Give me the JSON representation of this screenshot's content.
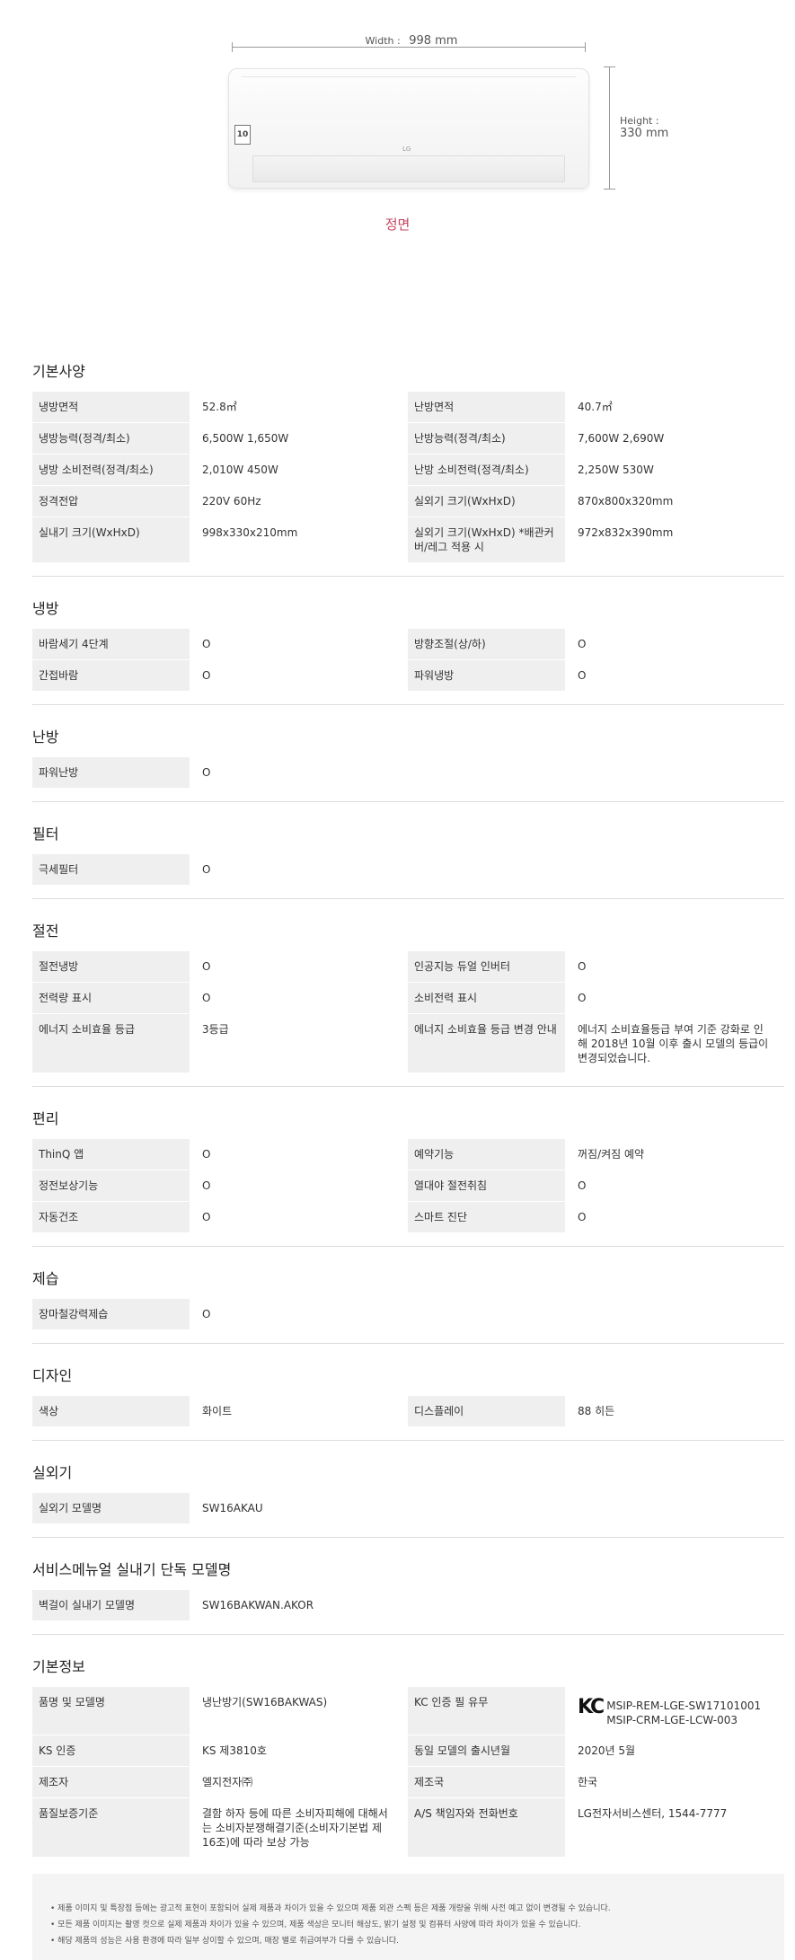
{
  "hero": {
    "width_label": "Width :",
    "width_value": "998 mm",
    "height_label": "Height :",
    "height_value": "330 mm",
    "badge_text": "10",
    "logo_text": "LG",
    "caption": "정면"
  },
  "sections": [
    {
      "title": "기본사양",
      "rows": [
        [
          "냉방면적",
          "52.8㎡",
          "난방면적",
          "40.7㎡"
        ],
        [
          "냉방능력(정격/최소)",
          "6,500W 1,650W",
          "난방능력(정격/최소)",
          "7,600W 2,690W"
        ],
        [
          "냉방 소비전력(정격/최소)",
          "2,010W 450W",
          "난방 소비전력(정격/최소)",
          "2,250W 530W"
        ],
        [
          "정격전압",
          "220V 60Hz",
          "실외기 크기(WxHxD)",
          "870x800x320mm"
        ],
        [
          "실내기 크기(WxHxD)",
          "998x330x210mm",
          "실외기 크기(WxHxD) *배관커버/레그 적용 시",
          "972x832x390mm"
        ]
      ]
    },
    {
      "title": "냉방",
      "rows": [
        [
          "바람세기 4단계",
          "O",
          "방향조절(상/하)",
          "O"
        ],
        [
          "간접바람",
          "O",
          "파워냉방",
          "O"
        ]
      ]
    },
    {
      "title": "난방",
      "rows": [
        [
          "파워난방",
          "O",
          "",
          ""
        ]
      ]
    },
    {
      "title": "필터",
      "rows": [
        [
          "극세필터",
          "O",
          "",
          ""
        ]
      ]
    },
    {
      "title": "절전",
      "rows": [
        [
          "절전냉방",
          "O",
          "인공지능 듀얼 인버터",
          "O"
        ],
        [
          "전력량 표시",
          "O",
          "소비전력 표시",
          "O"
        ],
        [
          "에너지 소비효율 등급",
          "3등급",
          "에너지 소비효율 등급 변경 안내",
          "에너지 소비효율등급 부여 기준 강화로 인해 2018년 10월 이후 출시 모델의 등급이 변경되었습니다."
        ]
      ]
    },
    {
      "title": "편리",
      "rows": [
        [
          "ThinQ 앱",
          "O",
          "예약기능",
          "꺼짐/켜짐 예약"
        ],
        [
          "정전보상기능",
          "O",
          "열대야 절전취침",
          "O"
        ],
        [
          "자동건조",
          "O",
          "스마트 진단",
          "O"
        ]
      ]
    },
    {
      "title": "제습",
      "rows": [
        [
          "장마철강력제습",
          "O",
          "",
          ""
        ]
      ]
    },
    {
      "title": "디자인",
      "rows": [
        [
          "색상",
          "화이트",
          "디스플레이",
          "88 히든"
        ]
      ]
    },
    {
      "title": "실외기",
      "rows": [
        [
          "실외기 모델명",
          "SW16AKAU",
          "",
          ""
        ]
      ]
    },
    {
      "title": "서비스메뉴얼 실내기 단독 모델명",
      "rows": [
        [
          "벽걸이 실내기 모델명",
          "SW16BAKWAN.AKOR",
          "",
          ""
        ]
      ]
    }
  ],
  "basic_info": {
    "title": "기본정보",
    "kc_mark": "KC",
    "rows": [
      [
        "품명 및 모델명",
        "냉난방기(SW16BAKWAS)",
        "KC 인증 필 유무",
        "MSIP-REM-LGE-SW17101001\nMSIP-CRM-LGE-LCW-003"
      ],
      [
        "KS 인증",
        "KS 제3810호",
        "동일 모델의 출시년월",
        "2020년 5월"
      ],
      [
        "제조자",
        "엘지전자㈜",
        "제조국",
        "한국"
      ],
      [
        "품질보증기준",
        "결함 하자 등에 따른 소비자피해에 대해서는 소비자분쟁해결기준(소비자기본법 제 16조)에 따라 보상 가능",
        "A/S 책임자와 전화번호",
        "LG전자서비스센터, 1544-7777"
      ]
    ]
  },
  "notes": [
    "제품 이미지 및 특장점 등에는 광고적 표현이 포함되어 실제 제품과 차이가 있을 수 있으며 제품 외관 스펙 등은 제품 개량을 위해 사전 예고 없이 변경될 수 있습니다.",
    "모든 제품 이미지는 촬영 컷으로 실제 제품과 차이가 있을 수 있으며, 제품 색상은 모니터 해상도, 밝기 설정 및 컴퓨터 사양에 따라 차이가 있을 수 있습니다.",
    "해당 제품의 성능은 사용 환경에 따라 일부 상이할 수 있으며, 매장 별로 취급여부가 다를 수 있습니다."
  ]
}
